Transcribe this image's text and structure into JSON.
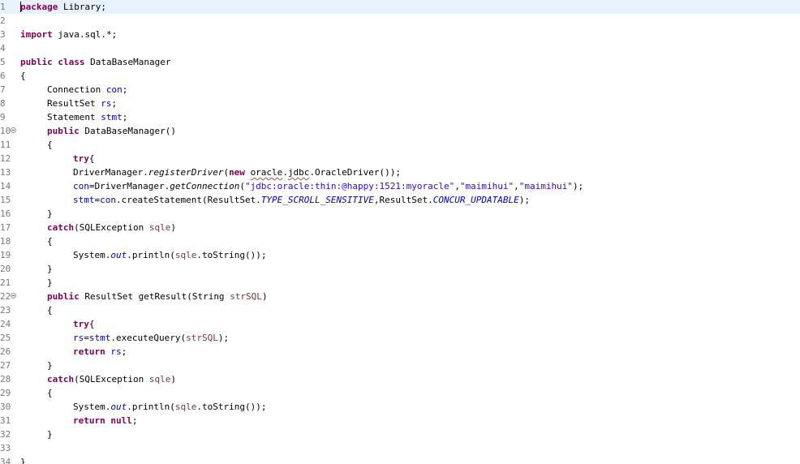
{
  "editor": {
    "line_numbers": [
      "1",
      "2",
      "3",
      "4",
      "5",
      "6",
      "7",
      "8",
      "9",
      "10",
      "11",
      "12",
      "13",
      "14",
      "15",
      "16",
      "17",
      "18",
      "19",
      "20",
      "21",
      "22",
      "23",
      "24",
      "25",
      "26",
      "27",
      "28",
      "29",
      "30",
      "31",
      "32",
      "33",
      "34"
    ],
    "fold_markers": [
      "10",
      "22"
    ]
  },
  "code": {
    "l1_kw": "package",
    "l1_rest": " Library;",
    "l3_kw": "import",
    "l3_rest": " java.sql.*;",
    "l5_kw": "public class",
    "l5_rest": " DataBaseManager",
    "l6": "{",
    "l7_type": "Connection ",
    "l7_field": "con",
    "l7_end": ";",
    "l8_type": "ResultSet ",
    "l8_field": "rs",
    "l8_end": ";",
    "l9_type": "Statement ",
    "l9_field": "stmt",
    "l9_end": ";",
    "l10_kw": "public",
    "l10_rest": " DataBaseManager()",
    "l11": "{",
    "l12_kw": "try",
    "l12_rest": "{",
    "l13_a": "DriverManager.",
    "l13_method": "registerDriver",
    "l13_b": "(",
    "l13_kw": "new",
    "l13_c": " ",
    "l13_pkg1": "oracle",
    "l13_dot": ".",
    "l13_pkg2": "jdbc",
    "l13_d": ".OracleDriver());",
    "l14_field": "con",
    "l14_a": "=DriverManager.",
    "l14_method": "getConnection",
    "l14_b": "(",
    "l14_s1": "\"jdbc:oracle:thin:@happy:1521:myoracle\"",
    "l14_c1": ",",
    "l14_s2": "\"maimihui\"",
    "l14_c2": ",",
    "l14_s3": "\"maimihui\"",
    "l14_d": ");",
    "l15_field1": "stmt",
    "l15_a": "=",
    "l15_field2": "con",
    "l15_b": ".createStatement(ResultSet.",
    "l15_const1": "TYPE_SCROLL_SENSITIVE",
    "l15_c": ",ResultSet.",
    "l15_const2": "CONCUR_UPDATABLE",
    "l15_d": ");",
    "l16": "}",
    "l17_kw": "catch",
    "l17_a": "(SQLException ",
    "l17_var": "sqle",
    "l17_b": ")",
    "l18": "{",
    "l19_a": "System.",
    "l19_field": "out",
    "l19_b": ".println(",
    "l19_var": "sqle",
    "l19_c": ".toString());",
    "l20": "}",
    "l21": "}",
    "l22_kw": "public",
    "l22_a": " ResultSet getResult(String ",
    "l22_var": "strSQL",
    "l22_b": ")",
    "l23": "{",
    "l24_kw": "try",
    "l24_rest": "{",
    "l25_field1": "rs",
    "l25_a": "=",
    "l25_field2": "stmt",
    "l25_b": ".executeQuery(",
    "l25_var": "strSQL",
    "l25_c": ");",
    "l26_kw": "return",
    "l26_a": " ",
    "l26_field": "rs",
    "l26_b": ";",
    "l27": "}",
    "l28_kw": "catch",
    "l28_a": "(SQLException ",
    "l28_var": "sqle",
    "l28_b": ")",
    "l29": "{",
    "l30_a": "System.",
    "l30_field": "out",
    "l30_b": ".println(",
    "l30_var": "sqle",
    "l30_c": ".toString());",
    "l31_kw": "return",
    "l31_a": " ",
    "l31_kw2": "null",
    "l31_b": ";",
    "l32": "}",
    "l34": "}"
  },
  "colors": {
    "keyword": "#7f0055",
    "field": "#0000c0",
    "string": "#2a00ff",
    "local_variable": "#6a3e3e",
    "line_number": "#787878",
    "current_line": "#e8f2fe"
  }
}
